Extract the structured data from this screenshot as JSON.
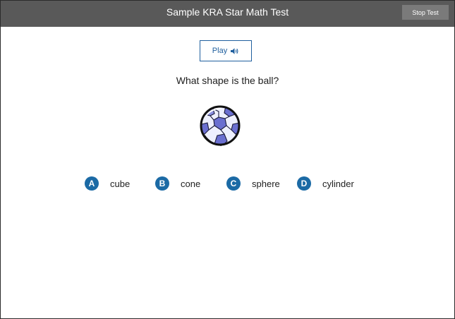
{
  "header": {
    "title": "Sample KRA Star Math Test",
    "stop_label": "Stop Test"
  },
  "play": {
    "label": "Play",
    "icon": "speaker-icon"
  },
  "question": {
    "text": "What shape is the ball?",
    "image": "soccer-ball-image"
  },
  "answers": [
    {
      "letter": "A",
      "text": "cube"
    },
    {
      "letter": "B",
      "text": "cone"
    },
    {
      "letter": "C",
      "text": "sphere"
    },
    {
      "letter": "D",
      "text": "cylinder"
    }
  ],
  "colors": {
    "header_bg": "#595959",
    "accent": "#1b6aa5",
    "ball_patch": "#6a6fd0"
  }
}
